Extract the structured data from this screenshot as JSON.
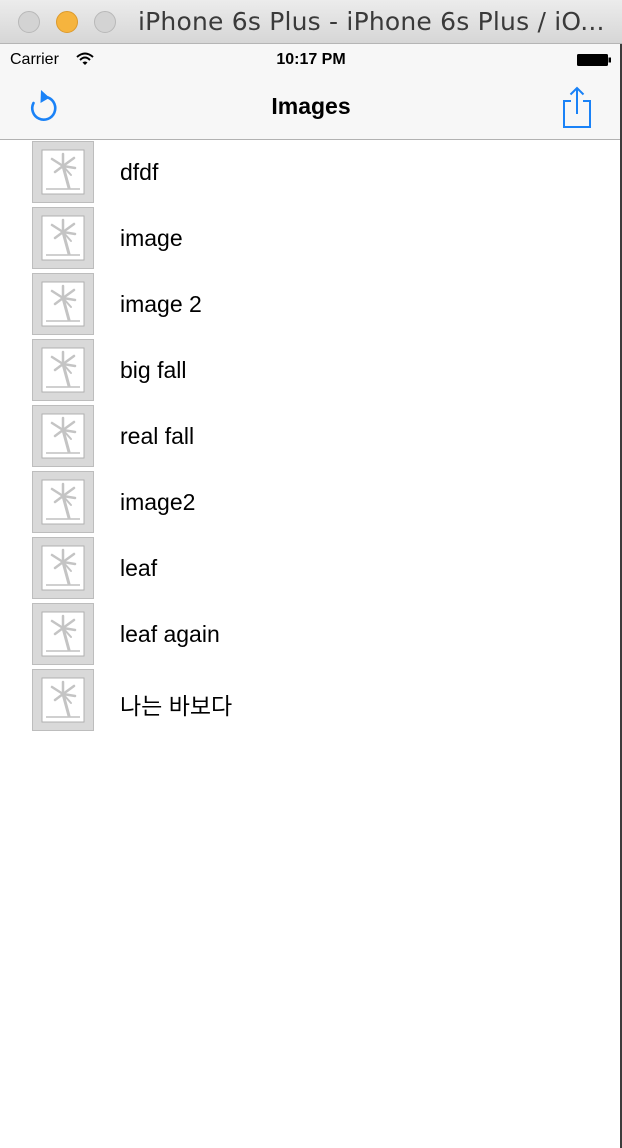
{
  "window": {
    "title": "iPhone 6s Plus - iPhone 6s Plus / iO..."
  },
  "status_bar": {
    "carrier": "Carrier",
    "time": "10:17 PM"
  },
  "nav": {
    "title": "Images",
    "left_icon": "refresh-icon",
    "right_icon": "share-icon",
    "tint_color": "#1a82f7"
  },
  "images": [
    {
      "label": "dfdf"
    },
    {
      "label": "image"
    },
    {
      "label": "image 2"
    },
    {
      "label": "big fall"
    },
    {
      "label": "real fall"
    },
    {
      "label": "image2"
    },
    {
      "label": "leaf"
    },
    {
      "label": "leaf again"
    },
    {
      "label": "나는 바보다"
    }
  ]
}
